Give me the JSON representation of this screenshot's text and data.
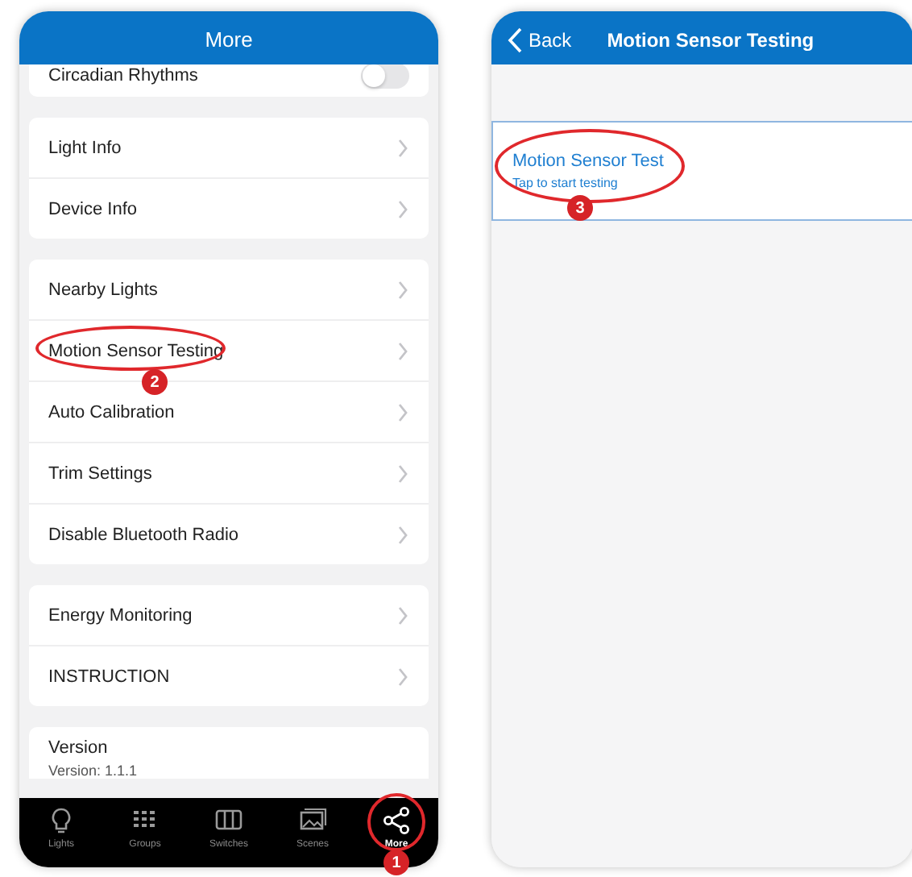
{
  "left_screen": {
    "title": "More",
    "groups": [
      {
        "items": [
          {
            "kind": "toggle",
            "label": "Circadian Rhythms",
            "on": false
          }
        ]
      },
      {
        "items": [
          {
            "kind": "link",
            "label": "Light Info"
          },
          {
            "kind": "link",
            "label": "Device Info"
          }
        ]
      },
      {
        "items": [
          {
            "kind": "link",
            "label": "Nearby Lights"
          },
          {
            "kind": "link",
            "label": "Motion Sensor Testing",
            "callout": "2"
          },
          {
            "kind": "link",
            "label": "Auto Calibration"
          },
          {
            "kind": "link",
            "label": "Trim Settings"
          },
          {
            "kind": "link",
            "label": "Disable Bluetooth Radio"
          }
        ]
      },
      {
        "items": [
          {
            "kind": "link",
            "label": "Energy Monitoring"
          },
          {
            "kind": "link",
            "label": "INSTRUCTION"
          }
        ]
      },
      {
        "items": [
          {
            "kind": "info",
            "label": "Version",
            "detail": "Version: 1.1.1"
          }
        ]
      }
    ],
    "tab_bar": [
      {
        "kind": "bulb",
        "label": "Lights",
        "selected": false
      },
      {
        "kind": "grid",
        "label": "Groups",
        "selected": false
      },
      {
        "kind": "panel",
        "label": "Switches",
        "selected": false
      },
      {
        "kind": "picture",
        "label": "Scenes",
        "selected": false
      },
      {
        "kind": "share",
        "label": "More",
        "selected": true,
        "callout": "1"
      }
    ]
  },
  "right_screen": {
    "back": "Back",
    "title": "Motion Sensor Testing",
    "items": [
      {
        "title": "Motion Sensor Test",
        "subtitle": "Tap to start testing",
        "callout": "3"
      }
    ]
  }
}
